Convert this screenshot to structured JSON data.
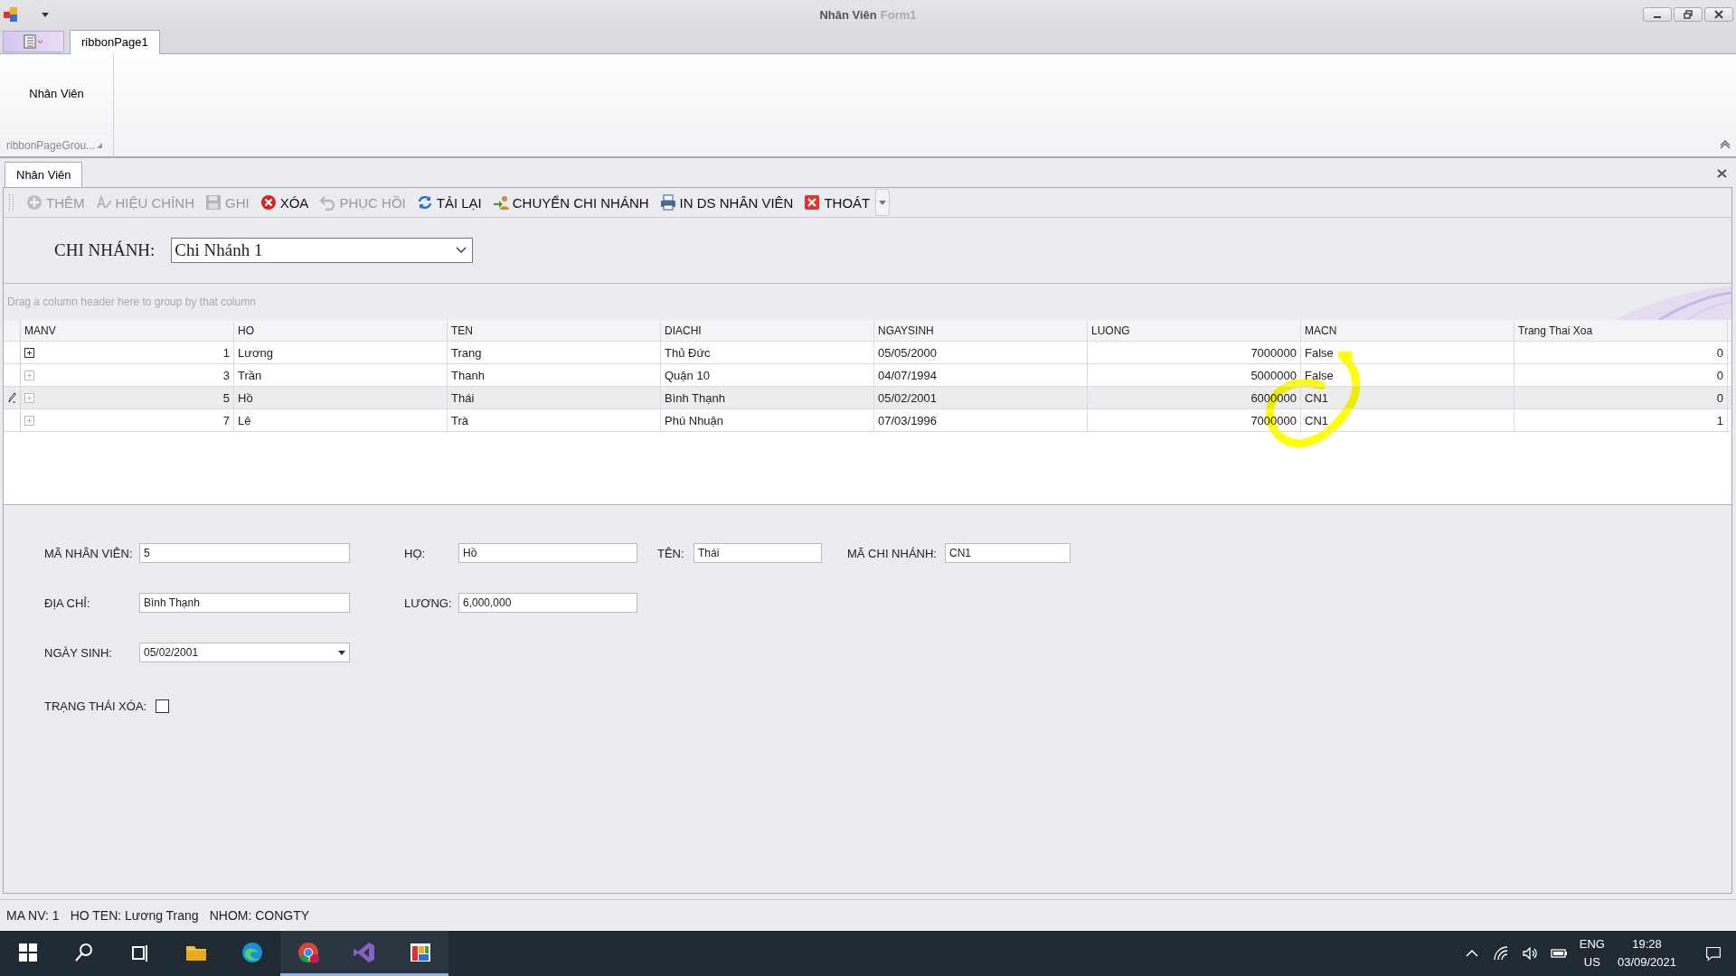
{
  "window": {
    "title": "Nhân Viên",
    "subtitle": "Form1"
  },
  "ribbon": {
    "tabs": [
      {
        "label": "ribbonPage1",
        "selected": true
      }
    ],
    "group": {
      "button": "Nhân Viên",
      "caption": "ribbonPageGrou..."
    }
  },
  "document_tabs": [
    {
      "label": "Nhân Viên",
      "selected": true
    }
  ],
  "toolbar": [
    {
      "label": "THÊM",
      "kind": "add",
      "disabled": true
    },
    {
      "label": "HIỆU CHỈNH",
      "kind": "edit",
      "disabled": true
    },
    {
      "label": "GHI",
      "kind": "save",
      "disabled": true
    },
    {
      "label": "XÓA",
      "kind": "delete",
      "disabled": false
    },
    {
      "label": "PHỤC HỒI",
      "kind": "undo",
      "disabled": true
    },
    {
      "label": "TẢI LẠI",
      "kind": "refresh",
      "disabled": false
    },
    {
      "label": "CHUYỂN CHI NHÁNH",
      "kind": "transfer",
      "disabled": false
    },
    {
      "label": "IN DS NHÂN VIÊN",
      "kind": "print",
      "disabled": false
    },
    {
      "label": "THOÁT",
      "kind": "exit",
      "disabled": false
    }
  ],
  "branch": {
    "label": "CHI NHÁNH:",
    "value": "Chi Nhánh 1"
  },
  "grid": {
    "group_hint": "Drag a column header here to group by that column",
    "columns": [
      {
        "label": "MANV",
        "numeric": true
      },
      {
        "label": "HO",
        "numeric": false
      },
      {
        "label": "TEN",
        "numeric": false
      },
      {
        "label": "DIACHI",
        "numeric": false
      },
      {
        "label": "NGAYSINH",
        "numeric": false
      },
      {
        "label": "LUONG",
        "numeric": true
      },
      {
        "label": "MACN",
        "numeric": false
      },
      {
        "label": "Trang Thai Xoa",
        "numeric": true
      }
    ],
    "rows": [
      {
        "selected": false,
        "cells": [
          "1",
          "Lương",
          "Trang",
          "Thủ Đức",
          "05/05/2000",
          "7000000",
          "False",
          "0"
        ]
      },
      {
        "selected": false,
        "cells": [
          "3",
          "Trần",
          "Thanh",
          "Quận 10",
          "04/07/1994",
          "5000000",
          "False",
          "0"
        ]
      },
      {
        "selected": true,
        "cells": [
          "5",
          "Hồ",
          "Thái",
          "Bình Thạnh",
          "05/02/2001",
          "6000000",
          "CN1",
          "0"
        ]
      },
      {
        "selected": false,
        "cells": [
          "7",
          "Lê",
          "Trà",
          "Phú Nhuận",
          "07/03/1996",
          "7000000",
          "CN1",
          "1"
        ]
      }
    ]
  },
  "form": {
    "rows": [
      [
        {
          "label": "MÃ NHÂN VIÊN:",
          "value": "5",
          "kind": "text"
        },
        {
          "label": "HỌ:",
          "value": "Hồ",
          "kind": "text"
        },
        {
          "label": "TÊN:",
          "value": "Thái",
          "kind": "text"
        },
        {
          "label": "MÃ CHI NHÁNH:",
          "value": "CN1",
          "kind": "text"
        }
      ],
      [
        {
          "label": "ĐỊA CHỈ:",
          "value": "Bình Thạnh",
          "kind": "text"
        },
        {
          "label": "LƯƠNG:",
          "value": "6,000,000",
          "kind": "text"
        }
      ],
      [
        {
          "label": "NGÀY SINH:",
          "value": "05/02/2001",
          "kind": "date"
        }
      ]
    ],
    "checkbox": {
      "label": "TRẠNG THÁI XÓA:",
      "checked": false
    }
  },
  "status_bar": [
    "MA NV: 1",
    "HO TEN: Lương Trang",
    "NHOM: CONGTY"
  ],
  "taskbar": {
    "apps": [
      {
        "kind": "start",
        "active": false
      },
      {
        "kind": "search",
        "active": false
      },
      {
        "kind": "taskview",
        "active": false
      },
      {
        "kind": "folder",
        "active": false
      },
      {
        "kind": "edge",
        "active": false
      },
      {
        "kind": "chrome",
        "active": true
      },
      {
        "kind": "vs",
        "active": true
      },
      {
        "kind": "app",
        "active": true
      }
    ],
    "language": [
      "ENG",
      "US"
    ],
    "time": "19:28",
    "date": "03/09/2021"
  }
}
